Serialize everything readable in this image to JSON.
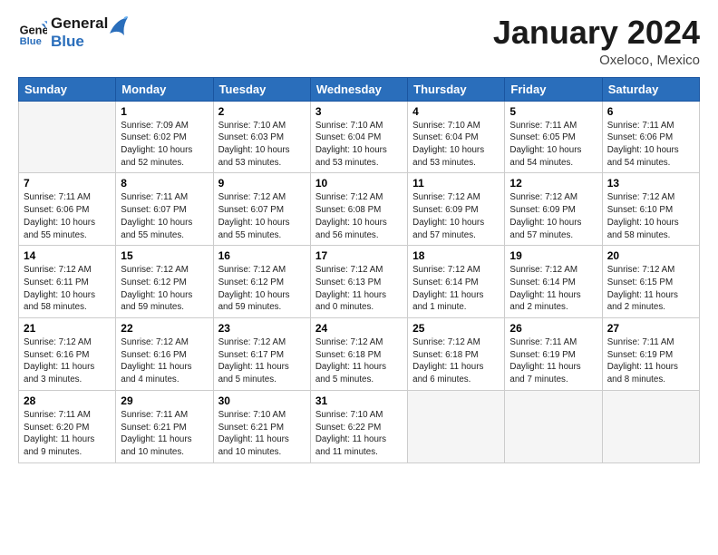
{
  "header": {
    "logo_line1": "General",
    "logo_line2": "Blue",
    "title": "January 2024",
    "location": "Oxeloco, Mexico"
  },
  "days_of_week": [
    "Sunday",
    "Monday",
    "Tuesday",
    "Wednesday",
    "Thursday",
    "Friday",
    "Saturday"
  ],
  "weeks": [
    [
      {
        "day": "",
        "empty": true
      },
      {
        "day": "1",
        "sunrise": "7:09 AM",
        "sunset": "6:02 PM",
        "daylight": "10 hours and 52 minutes."
      },
      {
        "day": "2",
        "sunrise": "7:10 AM",
        "sunset": "6:03 PM",
        "daylight": "10 hours and 53 minutes."
      },
      {
        "day": "3",
        "sunrise": "7:10 AM",
        "sunset": "6:04 PM",
        "daylight": "10 hours and 53 minutes."
      },
      {
        "day": "4",
        "sunrise": "7:10 AM",
        "sunset": "6:04 PM",
        "daylight": "10 hours and 53 minutes."
      },
      {
        "day": "5",
        "sunrise": "7:11 AM",
        "sunset": "6:05 PM",
        "daylight": "10 hours and 54 minutes."
      },
      {
        "day": "6",
        "sunrise": "7:11 AM",
        "sunset": "6:06 PM",
        "daylight": "10 hours and 54 minutes."
      }
    ],
    [
      {
        "day": "7",
        "sunrise": "7:11 AM",
        "sunset": "6:06 PM",
        "daylight": "10 hours and 55 minutes."
      },
      {
        "day": "8",
        "sunrise": "7:11 AM",
        "sunset": "6:07 PM",
        "daylight": "10 hours and 55 minutes."
      },
      {
        "day": "9",
        "sunrise": "7:12 AM",
        "sunset": "6:07 PM",
        "daylight": "10 hours and 55 minutes."
      },
      {
        "day": "10",
        "sunrise": "7:12 AM",
        "sunset": "6:08 PM",
        "daylight": "10 hours and 56 minutes."
      },
      {
        "day": "11",
        "sunrise": "7:12 AM",
        "sunset": "6:09 PM",
        "daylight": "10 hours and 57 minutes."
      },
      {
        "day": "12",
        "sunrise": "7:12 AM",
        "sunset": "6:09 PM",
        "daylight": "10 hours and 57 minutes."
      },
      {
        "day": "13",
        "sunrise": "7:12 AM",
        "sunset": "6:10 PM",
        "daylight": "10 hours and 58 minutes."
      }
    ],
    [
      {
        "day": "14",
        "sunrise": "7:12 AM",
        "sunset": "6:11 PM",
        "daylight": "10 hours and 58 minutes."
      },
      {
        "day": "15",
        "sunrise": "7:12 AM",
        "sunset": "6:12 PM",
        "daylight": "10 hours and 59 minutes."
      },
      {
        "day": "16",
        "sunrise": "7:12 AM",
        "sunset": "6:12 PM",
        "daylight": "10 hours and 59 minutes."
      },
      {
        "day": "17",
        "sunrise": "7:12 AM",
        "sunset": "6:13 PM",
        "daylight": "11 hours and 0 minutes."
      },
      {
        "day": "18",
        "sunrise": "7:12 AM",
        "sunset": "6:14 PM",
        "daylight": "11 hours and 1 minute."
      },
      {
        "day": "19",
        "sunrise": "7:12 AM",
        "sunset": "6:14 PM",
        "daylight": "11 hours and 2 minutes."
      },
      {
        "day": "20",
        "sunrise": "7:12 AM",
        "sunset": "6:15 PM",
        "daylight": "11 hours and 2 minutes."
      }
    ],
    [
      {
        "day": "21",
        "sunrise": "7:12 AM",
        "sunset": "6:16 PM",
        "daylight": "11 hours and 3 minutes."
      },
      {
        "day": "22",
        "sunrise": "7:12 AM",
        "sunset": "6:16 PM",
        "daylight": "11 hours and 4 minutes."
      },
      {
        "day": "23",
        "sunrise": "7:12 AM",
        "sunset": "6:17 PM",
        "daylight": "11 hours and 5 minutes."
      },
      {
        "day": "24",
        "sunrise": "7:12 AM",
        "sunset": "6:18 PM",
        "daylight": "11 hours and 5 minutes."
      },
      {
        "day": "25",
        "sunrise": "7:12 AM",
        "sunset": "6:18 PM",
        "daylight": "11 hours and 6 minutes."
      },
      {
        "day": "26",
        "sunrise": "7:11 AM",
        "sunset": "6:19 PM",
        "daylight": "11 hours and 7 minutes."
      },
      {
        "day": "27",
        "sunrise": "7:11 AM",
        "sunset": "6:19 PM",
        "daylight": "11 hours and 8 minutes."
      }
    ],
    [
      {
        "day": "28",
        "sunrise": "7:11 AM",
        "sunset": "6:20 PM",
        "daylight": "11 hours and 9 minutes."
      },
      {
        "day": "29",
        "sunrise": "7:11 AM",
        "sunset": "6:21 PM",
        "daylight": "11 hours and 10 minutes."
      },
      {
        "day": "30",
        "sunrise": "7:10 AM",
        "sunset": "6:21 PM",
        "daylight": "11 hours and 10 minutes."
      },
      {
        "day": "31",
        "sunrise": "7:10 AM",
        "sunset": "6:22 PM",
        "daylight": "11 hours and 11 minutes."
      },
      {
        "day": "",
        "empty": true
      },
      {
        "day": "",
        "empty": true
      },
      {
        "day": "",
        "empty": true
      }
    ]
  ]
}
